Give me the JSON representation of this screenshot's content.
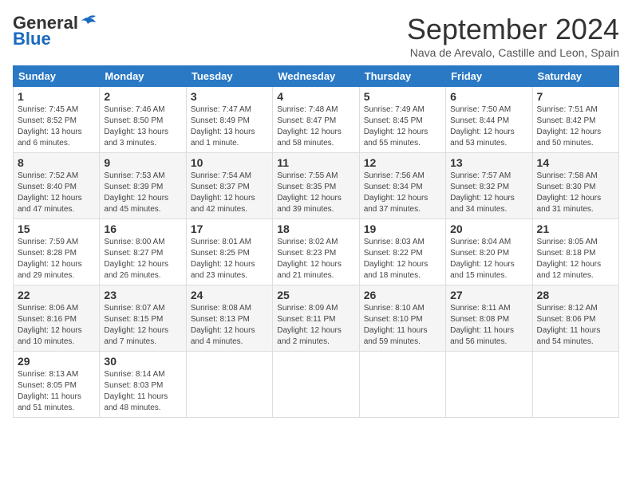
{
  "header": {
    "logo_line1": "General",
    "logo_line2": "Blue",
    "month_title": "September 2024",
    "location": "Nava de Arevalo, Castille and Leon, Spain"
  },
  "days_of_week": [
    "Sunday",
    "Monday",
    "Tuesday",
    "Wednesday",
    "Thursday",
    "Friday",
    "Saturday"
  ],
  "weeks": [
    [
      {
        "day": "1",
        "sunrise": "7:45 AM",
        "sunset": "8:52 PM",
        "daylight": "13 hours and 6 minutes."
      },
      {
        "day": "2",
        "sunrise": "7:46 AM",
        "sunset": "8:50 PM",
        "daylight": "13 hours and 3 minutes."
      },
      {
        "day": "3",
        "sunrise": "7:47 AM",
        "sunset": "8:49 PM",
        "daylight": "13 hours and 1 minute."
      },
      {
        "day": "4",
        "sunrise": "7:48 AM",
        "sunset": "8:47 PM",
        "daylight": "12 hours and 58 minutes."
      },
      {
        "day": "5",
        "sunrise": "7:49 AM",
        "sunset": "8:45 PM",
        "daylight": "12 hours and 55 minutes."
      },
      {
        "day": "6",
        "sunrise": "7:50 AM",
        "sunset": "8:44 PM",
        "daylight": "12 hours and 53 minutes."
      },
      {
        "day": "7",
        "sunrise": "7:51 AM",
        "sunset": "8:42 PM",
        "daylight": "12 hours and 50 minutes."
      }
    ],
    [
      {
        "day": "8",
        "sunrise": "7:52 AM",
        "sunset": "8:40 PM",
        "daylight": "12 hours and 47 minutes."
      },
      {
        "day": "9",
        "sunrise": "7:53 AM",
        "sunset": "8:39 PM",
        "daylight": "12 hours and 45 minutes."
      },
      {
        "day": "10",
        "sunrise": "7:54 AM",
        "sunset": "8:37 PM",
        "daylight": "12 hours and 42 minutes."
      },
      {
        "day": "11",
        "sunrise": "7:55 AM",
        "sunset": "8:35 PM",
        "daylight": "12 hours and 39 minutes."
      },
      {
        "day": "12",
        "sunrise": "7:56 AM",
        "sunset": "8:34 PM",
        "daylight": "12 hours and 37 minutes."
      },
      {
        "day": "13",
        "sunrise": "7:57 AM",
        "sunset": "8:32 PM",
        "daylight": "12 hours and 34 minutes."
      },
      {
        "day": "14",
        "sunrise": "7:58 AM",
        "sunset": "8:30 PM",
        "daylight": "12 hours and 31 minutes."
      }
    ],
    [
      {
        "day": "15",
        "sunrise": "7:59 AM",
        "sunset": "8:28 PM",
        "daylight": "12 hours and 29 minutes."
      },
      {
        "day": "16",
        "sunrise": "8:00 AM",
        "sunset": "8:27 PM",
        "daylight": "12 hours and 26 minutes."
      },
      {
        "day": "17",
        "sunrise": "8:01 AM",
        "sunset": "8:25 PM",
        "daylight": "12 hours and 23 minutes."
      },
      {
        "day": "18",
        "sunrise": "8:02 AM",
        "sunset": "8:23 PM",
        "daylight": "12 hours and 21 minutes."
      },
      {
        "day": "19",
        "sunrise": "8:03 AM",
        "sunset": "8:22 PM",
        "daylight": "12 hours and 18 minutes."
      },
      {
        "day": "20",
        "sunrise": "8:04 AM",
        "sunset": "8:20 PM",
        "daylight": "12 hours and 15 minutes."
      },
      {
        "day": "21",
        "sunrise": "8:05 AM",
        "sunset": "8:18 PM",
        "daylight": "12 hours and 12 minutes."
      }
    ],
    [
      {
        "day": "22",
        "sunrise": "8:06 AM",
        "sunset": "8:16 PM",
        "daylight": "12 hours and 10 minutes."
      },
      {
        "day": "23",
        "sunrise": "8:07 AM",
        "sunset": "8:15 PM",
        "daylight": "12 hours and 7 minutes."
      },
      {
        "day": "24",
        "sunrise": "8:08 AM",
        "sunset": "8:13 PM",
        "daylight": "12 hours and 4 minutes."
      },
      {
        "day": "25",
        "sunrise": "8:09 AM",
        "sunset": "8:11 PM",
        "daylight": "12 hours and 2 minutes."
      },
      {
        "day": "26",
        "sunrise": "8:10 AM",
        "sunset": "8:10 PM",
        "daylight": "11 hours and 59 minutes."
      },
      {
        "day": "27",
        "sunrise": "8:11 AM",
        "sunset": "8:08 PM",
        "daylight": "11 hours and 56 minutes."
      },
      {
        "day": "28",
        "sunrise": "8:12 AM",
        "sunset": "8:06 PM",
        "daylight": "11 hours and 54 minutes."
      }
    ],
    [
      {
        "day": "29",
        "sunrise": "8:13 AM",
        "sunset": "8:05 PM",
        "daylight": "11 hours and 51 minutes."
      },
      {
        "day": "30",
        "sunrise": "8:14 AM",
        "sunset": "8:03 PM",
        "daylight": "11 hours and 48 minutes."
      },
      null,
      null,
      null,
      null,
      null
    ]
  ]
}
